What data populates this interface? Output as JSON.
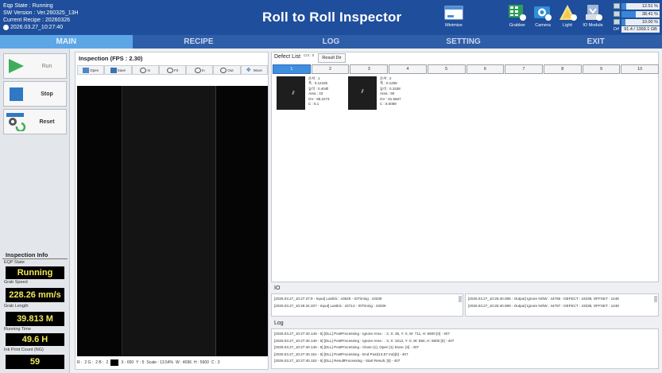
{
  "header": {
    "status_lines": [
      "Eqp State : Running",
      "SW Version : Ver.260325_13H",
      "Current Recipe : 20260326"
    ],
    "datetime": "2026.03.27_10:27:40",
    "title": "Roll to Roll Inspector",
    "buttons": {
      "minimize": "Minimize",
      "grabber": "Grabber",
      "camera": "Camera",
      "light": "Light",
      "io_module": "IO Module"
    },
    "gauges": [
      {
        "value": "12.51 %",
        "level": 0.1251
      },
      {
        "value": "38.41 %",
        "level": 0.3841
      },
      {
        "value": "10.00 %",
        "level": 0.1
      }
    ],
    "disk": {
      "label": "D#",
      "value": "91.4 / 1369.1 GB"
    }
  },
  "nav": {
    "tabs": [
      "MAIN",
      "RECIPE",
      "LOG",
      "SETTING",
      "EXIT"
    ],
    "active": "MAIN"
  },
  "controls": {
    "run": "Run",
    "stop": "Stop",
    "reset": "Reset"
  },
  "inspection_info": {
    "title": "Inspection Info",
    "eqp_state_label": "EQP State",
    "eqp_state": "Running",
    "grab_speed_label": "Grab Speed",
    "grab_speed": "228.26 mm/s",
    "grab_length_label": "Grab Length",
    "grab_length": "39.813 M",
    "running_time_label": "Running Time",
    "running_time": "49.6 H",
    "ink_print_label": "Ink Print Count (NG)",
    "ink_print": "59"
  },
  "inspection": {
    "title": "Inspection (FPS : 2.30)",
    "tools": [
      "Open",
      "Save",
      "In",
      "Fit",
      "In",
      "Out",
      "Move"
    ],
    "status": {
      "r": "R :",
      "g": "2 G :",
      "b": "2 B :",
      "b_value": "2",
      "x": "X : 650",
      "y": "Y : 5",
      "scale": "Scale : 13.54%",
      "w": "W : 4096",
      "h": "H : 5600",
      "c": "C : 3"
    }
  },
  "defect_list": {
    "title": "Defect List",
    "count": "Cnt : 0",
    "result_button": "Result Dir",
    "pages": [
      "1",
      "2",
      "3",
      "4",
      "5",
      "6",
      "7",
      "8",
      "9",
      "10"
    ],
    "active_page": "1",
    "items": [
      {
        "lines": [
          "순서 : 1",
          "폭 : 0.1215b",
          "높이 : 0.404ll",
          "Area : 43",
          "GV : 98.2273",
          "C : 5.1"
        ]
      },
      {
        "lines": [
          "순서 : 2",
          "폭 : 0.1258",
          "높이 : 0.1538",
          "Area : 90",
          "GV : 91.5667",
          "C : 8.0089"
        ]
      }
    ]
  },
  "io": {
    "title": "IO",
    "left": [
      "[2026.03.27_10:27:37:9 - Input] Lastlck : 43548 - IOTiming : 43339",
      "[2026.03.27_10:26:34.337 - Input] Lastlck : 43714 - IOTiming : 43339"
    ],
    "right": [
      "[2026.03.27_10:26:40.086 - Output] Ignore NOW : 44786 - DEFECT : 43338, OFFSET : 1248",
      "[2026.03.27_10:26:40.089 - Output] Ignore NOW : 44787 - DEFECT : 43338, OFFSET : 1248"
    ]
  },
  "log": {
    "title": "Log",
    "lines": [
      "[2026.03.27_10:27:40.146 - 5] [DLL] PostProcessing - Ignore Area : : 2, X: 36, Y: 0, W: 711, H: 5600 [0] - 407",
      "[2026.03.27_10:27:40.146 - 5] [DLL] PostProcessing - Ignore Area : : 3, X: 3212, Y: 0, W: 884, H: 5600 [0] - 407",
      "[2026.03.27_10:27:40.146 - 5] [DLL] PostProcessing - Close (1), Open (1) Done. [0] - 407",
      "[2026.03.27_10:27:40.151 - 5] [DLL] PostProcessing - End Post(13.57 ms)[0] - 407",
      "[2026.03.27_10:27:40.152 - 5] [DLL] ResultProcessing - Start Result. [0] - 407"
    ]
  }
}
